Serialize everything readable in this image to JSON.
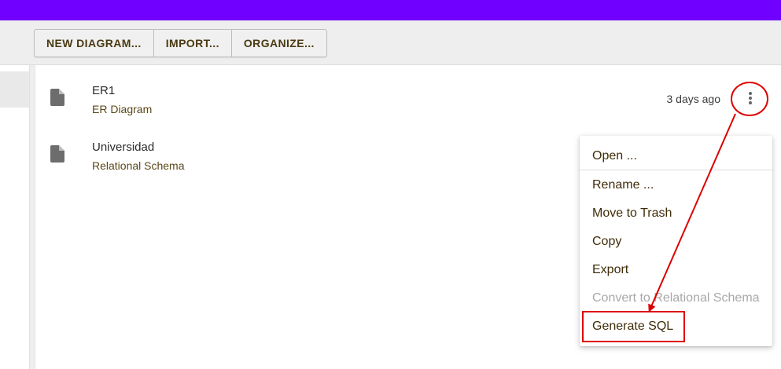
{
  "toolbar": {
    "buttons": [
      {
        "label": "NEW DIAGRAM..."
      },
      {
        "label": "IMPORT..."
      },
      {
        "label": "ORGANIZE..."
      }
    ]
  },
  "files": [
    {
      "name": "ER1",
      "type": "ER Diagram",
      "modified": "3 days ago",
      "icon": "file-icon"
    },
    {
      "name": "Universidad",
      "type": "Relational Schema",
      "modified": "",
      "icon": "file-icon"
    }
  ],
  "context_menu": {
    "items": [
      {
        "label": "Open ...",
        "enabled": true
      },
      {
        "label": "Rename ...",
        "enabled": true
      },
      {
        "label": "Move to Trash",
        "enabled": true
      },
      {
        "label": "Copy",
        "enabled": true
      },
      {
        "label": "Export",
        "enabled": true
      },
      {
        "label": "Convert to Relational Schema",
        "enabled": false
      },
      {
        "label": "Generate SQL",
        "enabled": true
      }
    ]
  },
  "colors": {
    "accent": "#7000ff",
    "annotation": "#dd0000",
    "text_brown": "#4a3a12",
    "disabled": "#a8a8a8"
  }
}
